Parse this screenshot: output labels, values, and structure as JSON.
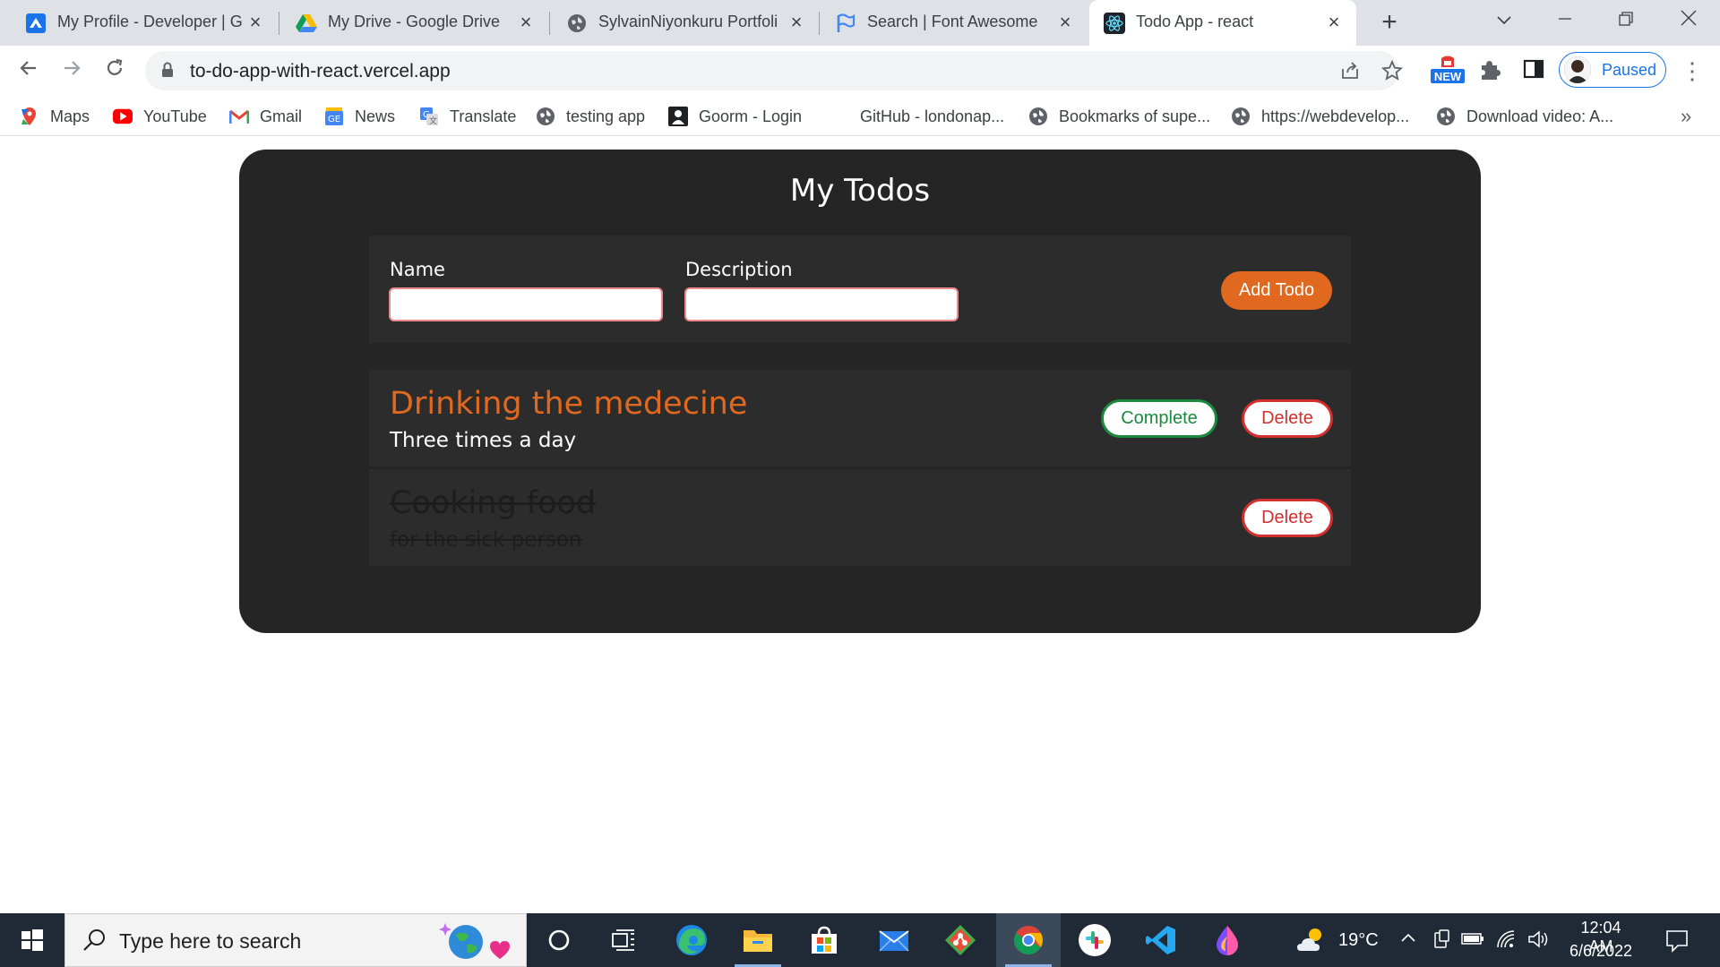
{
  "browser": {
    "tabs": [
      {
        "title": "My Profile - Developer | G",
        "icon": "developer-profile-icon"
      },
      {
        "title": "My Drive - Google Drive",
        "icon": "google-drive-icon"
      },
      {
        "title": "SylvainNiyonkuru Portfoli",
        "icon": "globe-icon"
      },
      {
        "title": "Search | Font Awesome",
        "icon": "flag-icon"
      },
      {
        "title": "Todo App - react",
        "icon": "react-icon",
        "active": true
      }
    ],
    "url": "to-do-app-with-react.vercel.app",
    "extension_badge": "NEW",
    "profile_status": "Paused",
    "bookmarks": [
      {
        "label": "Maps",
        "icon": "maps-icon"
      },
      {
        "label": "YouTube",
        "icon": "youtube-icon"
      },
      {
        "label": "Gmail",
        "icon": "gmail-icon"
      },
      {
        "label": "News",
        "icon": "news-icon"
      },
      {
        "label": "Translate",
        "icon": "translate-icon"
      },
      {
        "label": "testing app",
        "icon": "globe-icon"
      },
      {
        "label": "Goorm - Login",
        "icon": "person-icon"
      },
      {
        "label": "GitHub - londonap...",
        "icon": "none"
      },
      {
        "label": "Bookmarks of supe...",
        "icon": "globe-icon"
      },
      {
        "label": "https://webdevelop...",
        "icon": "globe-icon"
      },
      {
        "label": "Download video: A...",
        "icon": "globe-icon"
      }
    ],
    "bookmarks_overflow": "»"
  },
  "app": {
    "title": "My Todos",
    "form": {
      "name_label": "Name",
      "description_label": "Description",
      "name_value": "",
      "description_value": "",
      "add_button": "Add Todo"
    },
    "todos": [
      {
        "name": "Drinking the medecine",
        "description": "Three times a day",
        "completed": false,
        "complete_label": "Complete",
        "delete_label": "Delete"
      },
      {
        "name": "Cooking food",
        "description": "for the sick person",
        "completed": true,
        "delete_label": "Delete"
      }
    ],
    "colors": {
      "card": "#252525",
      "panel": "#2c2c2c",
      "accent": "#e0691f",
      "complete": "#1a8a3e",
      "delete": "#d32f2f"
    }
  },
  "taskbar": {
    "search_placeholder": "Type here to search",
    "apps": [
      "cortana-icon",
      "task-view-icon",
      "edge-icon",
      "file-explorer-icon",
      "microsoft-store-icon",
      "mail-icon",
      "git-icon",
      "chrome-icon",
      "slack-icon",
      "vscode-icon",
      "paint-icon"
    ],
    "weather": "19°C",
    "time": "12:04 AM",
    "date": "6/6/2022"
  }
}
